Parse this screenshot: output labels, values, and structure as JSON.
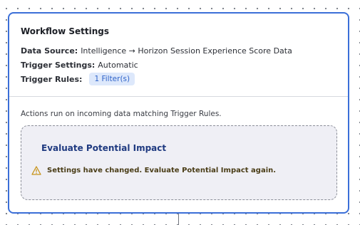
{
  "workflow": {
    "title": "Workflow Settings",
    "data_source_label": "Data Source:",
    "data_source_value": "Intelligence → Horizon Session Experience Score Data",
    "trigger_settings_label": "Trigger Settings:",
    "trigger_settings_value": "Automatic",
    "trigger_rules_label": "Trigger Rules:",
    "trigger_rules_value": "1 Filter(s)"
  },
  "actions": {
    "note": "Actions run on incoming data matching Trigger Rules.",
    "impact_title": "Evaluate Potential Impact",
    "warning_icon": "warning-triangle",
    "warning_text": "Settings have changed. Evaluate Potential Impact again."
  },
  "colors": {
    "accent": "#3b6fd8",
    "pill_bg": "#dde8fb",
    "impact_title": "#1f3a80",
    "warning": "#c7931a"
  }
}
